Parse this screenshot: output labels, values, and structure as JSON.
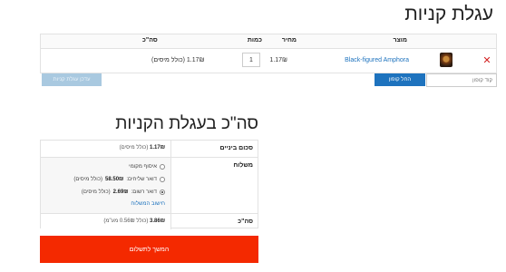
{
  "cart": {
    "title": "עגלת קניות",
    "headers": {
      "product": "מוצר",
      "price": "מחיר",
      "quantity": "כמות",
      "subtotal": "סה\"כ"
    },
    "items": [
      {
        "remove_icon": "✕",
        "name": "Black-figured Amphora",
        "price": "1.17₪",
        "quantity": "1",
        "subtotal": "1.17₪ (כולל מיסים)"
      }
    ],
    "coupon_placeholder": "קוד קופון",
    "apply_coupon": "החל קופון",
    "update_cart": "עדכן עגלת קניות"
  },
  "totals": {
    "title": "סה\"כ בעגלת הקניות",
    "subtotal_label": "סכום ביניים",
    "subtotal_value": "1.17₪",
    "subtotal_note": "(כולל מיסים)",
    "shipping_label": "משלוח",
    "shipping_options": [
      {
        "label": "איסוף מקומי",
        "price": "",
        "note": "",
        "checked": false
      },
      {
        "label": "דואר שליחים:",
        "price": "58.50₪",
        "note": "(כולל מיסים)",
        "checked": false
      },
      {
        "label": "דואר רשום:",
        "price": "2.69₪",
        "note": "(כולל מיסים)",
        "checked": true
      }
    ],
    "calculate_shipping": "חישוב המשלוח",
    "total_label": "סה\"כ",
    "total_value": "3.86₪",
    "total_note": "(כולל 0.56₪ מע\"מ)"
  },
  "checkout_button": "המשך לתשלום",
  "colors": {
    "link": "#1e73be",
    "checkout": "#f42900",
    "remove": "#d32020"
  }
}
